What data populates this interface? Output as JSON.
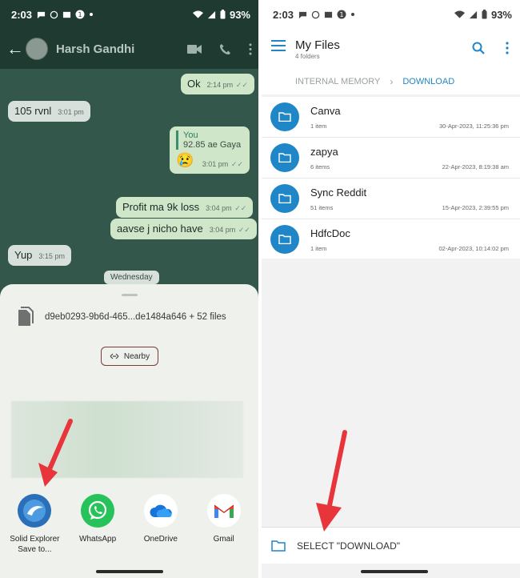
{
  "status_left": {
    "time": "2:03",
    "battery": "93%"
  },
  "status_right": {
    "time": "2:03",
    "battery": "93%"
  },
  "chat": {
    "contact_name": "Harsh Gandhi",
    "messages": [
      {
        "text": "Ok",
        "time": "2:14 pm",
        "dir": "out"
      },
      {
        "text": "105 rvnl",
        "time": "3:01 pm",
        "dir": "in"
      },
      {
        "quote_who": "You",
        "quote_text": "92.85 ae Gaya",
        "emoji": "😢",
        "time": "3:01 pm",
        "dir": "out"
      },
      {
        "text": "Profit ma 9k loss",
        "time": "3:04 pm",
        "dir": "out"
      },
      {
        "text": "aavse j nicho have",
        "time": "3:04 pm",
        "dir": "out"
      },
      {
        "text": "Yup",
        "time": "3:15 pm",
        "dir": "in"
      }
    ],
    "date_label": "Wednesday"
  },
  "share_sheet": {
    "file_label": "d9eb0293-9b6d-465...de1484a646 + 52 files",
    "nearby_label": "Nearby",
    "apps": [
      {
        "name": "Solid Explorer",
        "sub": "Save to...",
        "icon": "solid-explorer-icon"
      },
      {
        "name": "WhatsApp",
        "sub": "",
        "icon": "whatsapp-icon"
      },
      {
        "name": "OneDrive",
        "sub": "",
        "icon": "onedrive-icon"
      },
      {
        "name": "Gmail",
        "sub": "",
        "icon": "gmail-icon"
      }
    ]
  },
  "files": {
    "title": "My Files",
    "subtitle": "4 folders",
    "breadcrumb": [
      "INTERNAL MEMORY",
      "DOWNLOAD"
    ],
    "folders": [
      {
        "name": "Canva",
        "count": "1 item",
        "date": "30-Apr-2023, 11:25:36 pm"
      },
      {
        "name": "zapya",
        "count": "6 items",
        "date": "22-Apr-2023, 8:19:38 am"
      },
      {
        "name": "Sync Reddit",
        "count": "51 items",
        "date": "15-Apr-2023, 2:39:55 pm"
      },
      {
        "name": "HdfcDoc",
        "count": "1 item",
        "date": "02-Apr-2023, 10:14:02 pm"
      }
    ],
    "select_label": "SELECT \"DOWNLOAD\""
  },
  "colors": {
    "accent_blue": "#1f86c7",
    "arrow_red": "#e8343b",
    "chat_bg": "#33574a"
  }
}
